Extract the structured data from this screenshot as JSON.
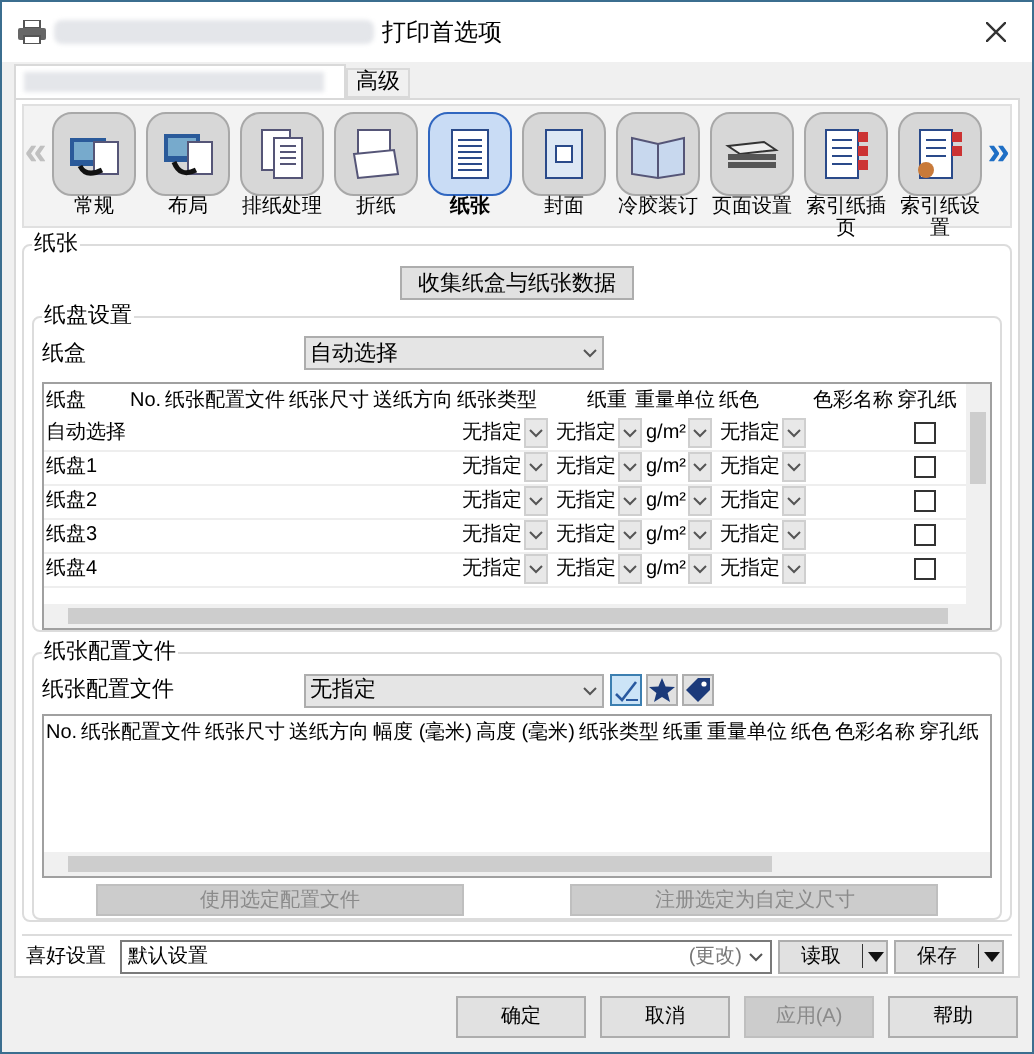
{
  "window": {
    "title": "打印首选项"
  },
  "tabs": [
    {
      "kind": "redacted",
      "selected": true
    },
    {
      "kind": "text",
      "label": "高级",
      "selected": false
    }
  ],
  "toolbar": {
    "prev": {
      "symbol": "«",
      "disabled": true
    },
    "next": {
      "symbol": "»",
      "disabled": false
    },
    "categories": [
      {
        "label": "常规",
        "selected": false
      },
      {
        "label": "布局",
        "selected": false
      },
      {
        "label": "排纸处理",
        "selected": false
      },
      {
        "label": "折纸",
        "selected": false
      },
      {
        "label": "纸张",
        "selected": true
      },
      {
        "label": "封面",
        "selected": false
      },
      {
        "label": "冷胶装订",
        "selected": false
      },
      {
        "label": "页面设置",
        "selected": false
      },
      {
        "label": "索引纸插页",
        "selected": false
      },
      {
        "label": "索引纸设置",
        "selected": false
      }
    ]
  },
  "paper": {
    "title": "纸张",
    "collect_button": "收集纸盒与纸张数据",
    "tray_settings": {
      "title": "纸盘设置",
      "cassette_label": "纸盒",
      "cassette": "自动选择",
      "columns": [
        "纸盘",
        "No.",
        "纸张配置文件",
        "纸张尺寸",
        "送纸方向",
        "纸张类型",
        "纸重",
        "重量单位",
        "纸色",
        "色彩名称",
        "穿孔纸"
      ],
      "rows": [
        {
          "tray": "自动选择",
          "paper_type": "无指定",
          "weight": "无指定",
          "weight_unit": "g/m²",
          "paper_color": "无指定",
          "punched": false
        },
        {
          "tray": "纸盘1",
          "paper_type": "无指定",
          "weight": "无指定",
          "weight_unit": "g/m²",
          "paper_color": "无指定",
          "punched": false
        },
        {
          "tray": "纸盘2",
          "paper_type": "无指定",
          "weight": "无指定",
          "weight_unit": "g/m²",
          "paper_color": "无指定",
          "punched": false
        },
        {
          "tray": "纸盘3",
          "paper_type": "无指定",
          "weight": "无指定",
          "weight_unit": "g/m²",
          "paper_color": "无指定",
          "punched": false
        },
        {
          "tray": "纸盘4",
          "paper_type": "无指定",
          "weight": "无指定",
          "weight_unit": "g/m²",
          "paper_color": "无指定",
          "punched": false
        }
      ]
    },
    "paper_profiles": {
      "title": "纸张配置文件",
      "label": "纸张配置文件",
      "value": "无指定",
      "tools": [
        {
          "kind": "check",
          "selected": true
        },
        {
          "kind": "star",
          "selected": false
        },
        {
          "kind": "tag",
          "selected": false
        }
      ],
      "columns": [
        "No.",
        "纸张配置文件",
        "纸张尺寸",
        "送纸方向",
        "幅度 (毫米)",
        "高度 (毫米)",
        "纸张类型",
        "纸重",
        "重量单位",
        "纸色",
        "色彩名称",
        "穿孔纸"
      ],
      "buttons": [
        {
          "label": "使用选定配置文件",
          "disabled": true
        },
        {
          "label": "注册选定为自定义尺寸",
          "disabled": true
        }
      ]
    }
  },
  "preferences": {
    "label": "喜好设置",
    "value": "默认设置",
    "status": "(更改)",
    "buttons": [
      "读取",
      "保存"
    ]
  },
  "dialog_buttons": [
    {
      "label": "确定",
      "disabled": false
    },
    {
      "label": "取消",
      "disabled": false
    },
    {
      "label": "应用(A)",
      "disabled": true
    },
    {
      "label": "帮助",
      "disabled": false
    }
  ]
}
